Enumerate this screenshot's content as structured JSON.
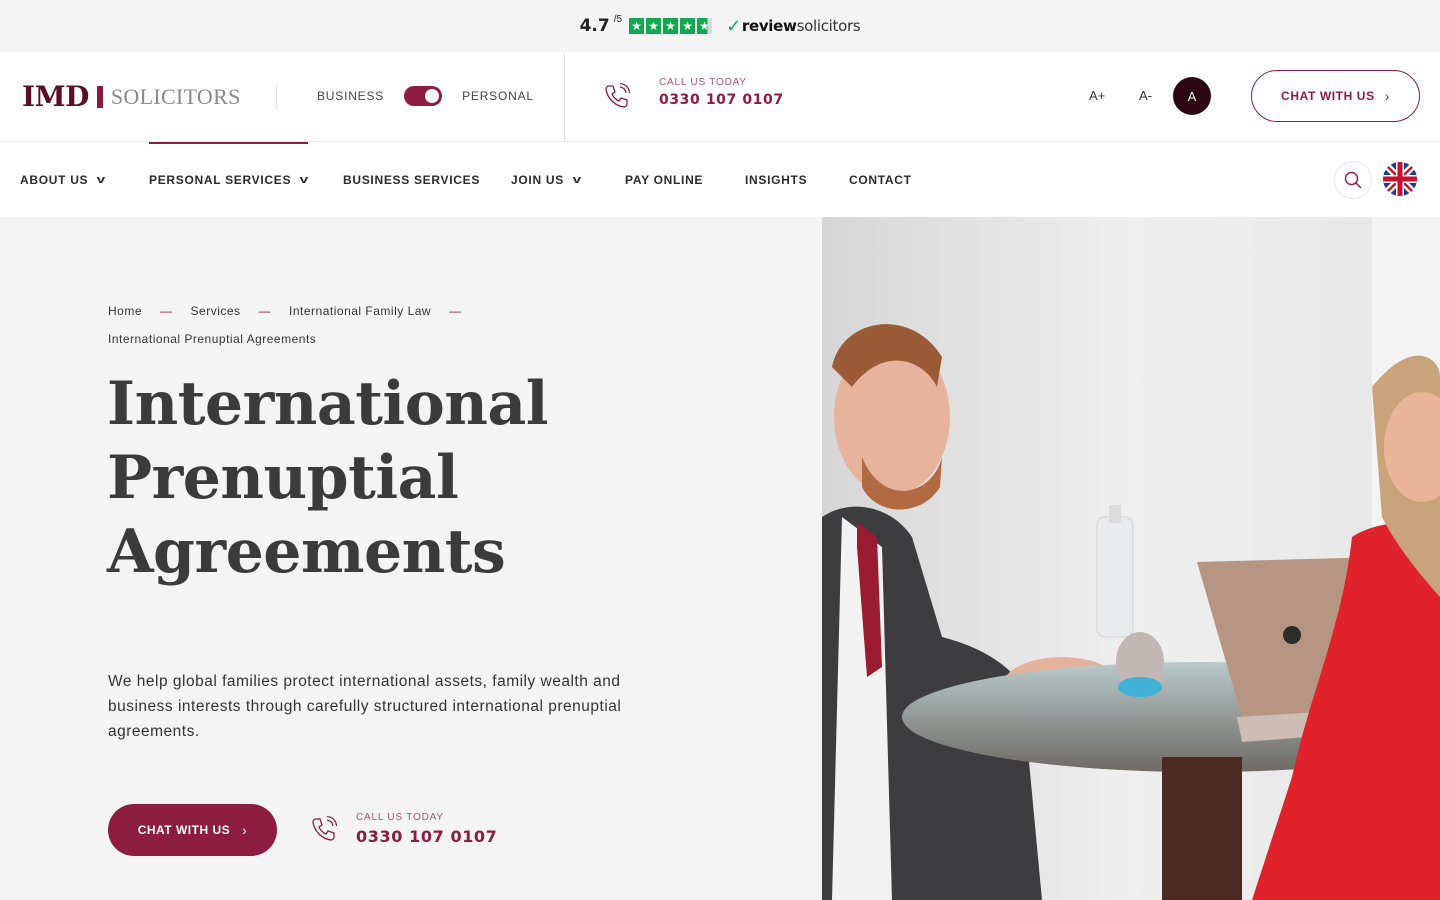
{
  "review_bar": {
    "rating": "4.7",
    "rating_out_of": "/5",
    "stars": 5,
    "brand_prefix": "review",
    "brand_suffix": "solicitors",
    "star_color": "#12a84f"
  },
  "header": {
    "logo_primary": "IMD",
    "logo_secondary": "SOLICITORS",
    "toggle": {
      "left_label": "BUSINESS",
      "right_label": "PERSONAL",
      "state": "personal"
    },
    "call_label": "CALL US TODAY",
    "call_number": "0330 107 0107",
    "font_increase": "A+",
    "font_decrease": "A-",
    "contrast_label": "A",
    "chat_button": "CHAT WITH US"
  },
  "nav": {
    "items": [
      {
        "label": "ABOUT US",
        "dropdown": true
      },
      {
        "label": "PERSONAL SERVICES",
        "dropdown": true,
        "active": true
      },
      {
        "label": "BUSINESS SERVICES",
        "dropdown": false
      },
      {
        "label": "JOIN US",
        "dropdown": true
      },
      {
        "label": "PAY ONLINE",
        "dropdown": false
      },
      {
        "label": "INSIGHTS",
        "dropdown": false
      },
      {
        "label": "CONTACT",
        "dropdown": false
      }
    ],
    "search_icon": "search-icon",
    "language_icon": "uk-flag-icon"
  },
  "hero": {
    "breadcrumb": [
      "Home",
      "Services",
      "International Family Law",
      "International Prenuptial Agreements"
    ],
    "breadcrumb_separator": "—",
    "title_lines": [
      "International",
      "Prenuptial",
      "Agreements"
    ],
    "description": "We help global families protect international assets, family wealth and business interests through carefully structured international prenuptial agreements.",
    "chat_button": "CHAT WITH US",
    "call_label": "CALL US TODAY",
    "call_number": "0330 107 0107"
  },
  "colors": {
    "brand": "#8c1d40",
    "brand_dark": "#2c0512",
    "hero_bg": "#f4f4f4"
  }
}
